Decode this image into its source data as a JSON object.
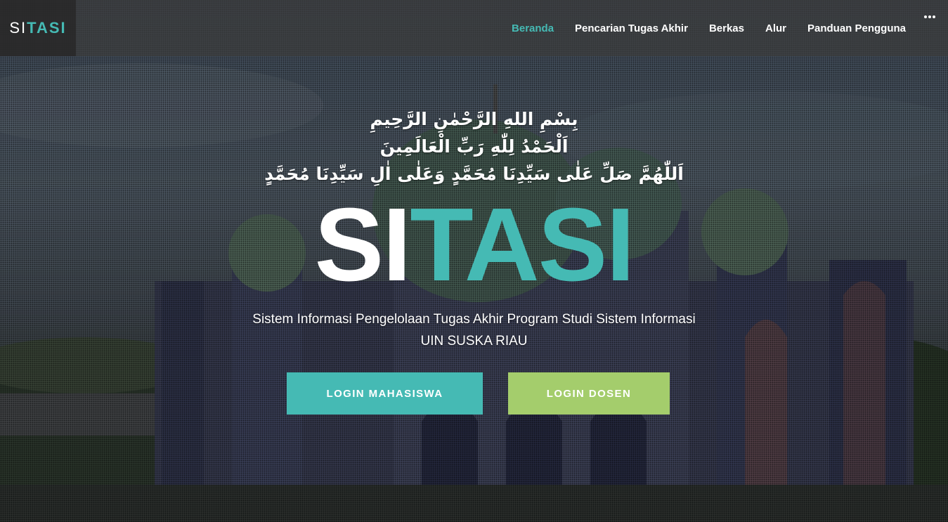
{
  "brand": {
    "si": "SI",
    "tasi": "TASI"
  },
  "nav": {
    "items": [
      {
        "label": "Beranda",
        "active": true
      },
      {
        "label": "Pencarian Tugas Akhir",
        "active": false
      },
      {
        "label": "Berkas",
        "active": false
      },
      {
        "label": "Alur",
        "active": false
      },
      {
        "label": "Panduan Pengguna",
        "active": false
      }
    ],
    "menu_icon": "more-dots-icon"
  },
  "hero": {
    "arabic_lines": [
      "بِسْمِ اللهِ الرَّحْمٰنِ الرَّحِيمِ",
      "اَلْحَمْدُ لِلّٰهِ رَبِّ الْعَالَمِينَ",
      "اَللّٰهُمَّ صَلِّ عَلٰى سَيِّدِنَا مُحَمَّدٍ وَعَلٰى اٰلِ سَيِّدِنَا مُحَمَّدٍ"
    ],
    "title_si": "SI",
    "title_tasi": "TASI",
    "subtitle_line1": "Sistem Informasi Pengelolaan Tugas Akhir Program Studi Sistem Informasi",
    "subtitle_line2": "UIN SUSKA RIAU",
    "buttons": {
      "mahasiswa": "LOGIN MAHASISWA",
      "dosen": "LOGIN DOSEN"
    }
  },
  "colors": {
    "accent_teal": "#45bab4",
    "accent_green": "#a4cd6c",
    "text_white": "#ffffff"
  }
}
